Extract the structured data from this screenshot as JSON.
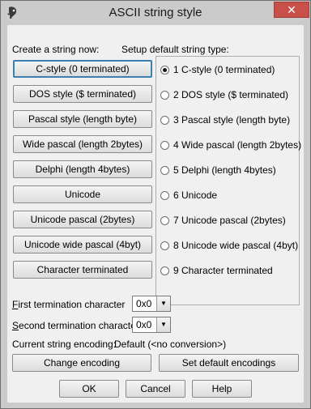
{
  "window": {
    "title": "ASCII string style",
    "close_glyph": "✕"
  },
  "left_panel": {
    "heading": "Create a string now:",
    "buttons": [
      "C-style (0 terminated)",
      "DOS style ($ terminated)",
      "Pascal style (length byte)",
      "Wide pascal (length 2bytes)",
      "Delphi      (length 4bytes)",
      "Unicode",
      "Unicode pascal (2bytes)",
      "Unicode wide pascal (4byt)",
      "Character terminated"
    ]
  },
  "right_panel": {
    "heading": "Setup default string type:",
    "selected_index": 0,
    "options": [
      "1 C-style (0 terminated)",
      "2 DOS style ($ terminated)",
      "3 Pascal style (length byte)",
      "4 Wide pascal (length 2bytes)",
      "5 Delphi      (length 4bytes)",
      "6 Unicode",
      "7 Unicode pascal (2bytes)",
      "8 Unicode wide pascal (4byt)",
      "9 Character terminated"
    ]
  },
  "termination": {
    "first": {
      "label_key": "F",
      "label_rest": "irst termination character",
      "value": "0x0"
    },
    "second": {
      "label_key": "S",
      "label_rest": "econd termination character",
      "value": "0x0"
    }
  },
  "encoding": {
    "label": "Current string encoding:",
    "value": "Default (<no conversion>)",
    "change_button": "Change encoding",
    "default_button": "Set default encodings"
  },
  "footer": {
    "ok": "OK",
    "cancel": "Cancel",
    "help": "Help"
  }
}
